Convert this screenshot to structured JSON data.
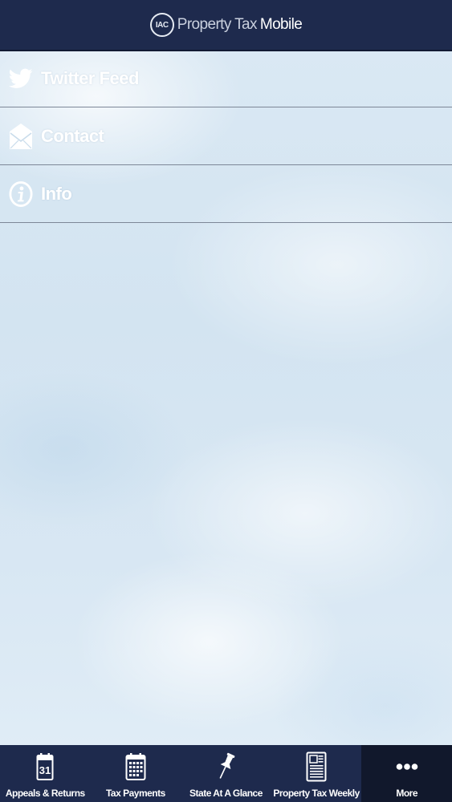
{
  "header": {
    "logo_text": "IAC",
    "title": "Property Tax",
    "title_suffix": "Mobile"
  },
  "menu": {
    "items": [
      {
        "label": "Twitter Feed",
        "icon": "twitter-bird-icon"
      },
      {
        "label": "Contact",
        "icon": "envelope-icon"
      },
      {
        "label": "Info",
        "icon": "info-icon"
      }
    ]
  },
  "tabbar": {
    "active_index": 4,
    "tabs": [
      {
        "label": "Appeals & Returns",
        "icon": "calendar-31-icon",
        "icon_text": "31"
      },
      {
        "label": "Tax Payments",
        "icon": "calendar-grid-icon"
      },
      {
        "label": "State At A Glance",
        "icon": "pushpin-icon"
      },
      {
        "label": "Property Tax Weekly",
        "icon": "newspaper-icon"
      },
      {
        "label": "More",
        "icon": "more-dots-icon"
      }
    ]
  },
  "colors": {
    "header_background": "#1e2a4d",
    "tabbar_background": "#1e2a4d",
    "active_tab_background": "#11182c",
    "menu_text": "#ffffff",
    "divider": "#7d8797"
  }
}
